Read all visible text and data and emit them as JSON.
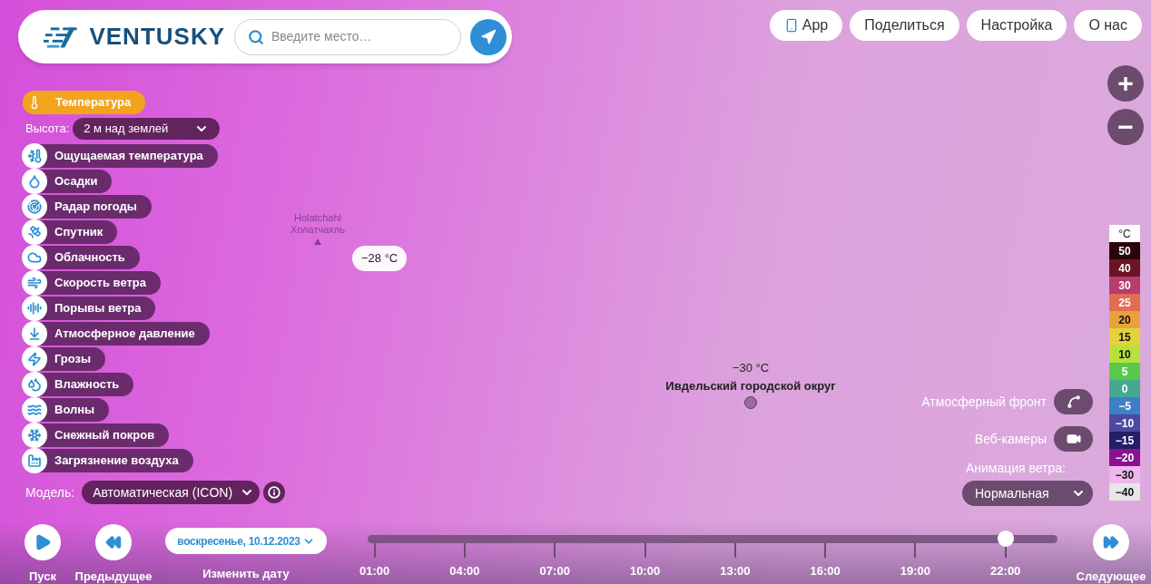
{
  "header": {
    "logo": "VENTUSKY",
    "search": {
      "placeholder": "Введите место…"
    }
  },
  "nav": [
    {
      "label": "App",
      "kind": "app"
    },
    {
      "label": "Поделиться",
      "kind": "plain"
    },
    {
      "label": "Настройка",
      "kind": "plain"
    },
    {
      "label": "О нас",
      "kind": "plain"
    }
  ],
  "zoom": {
    "in": "+",
    "out": "−"
  },
  "layers": {
    "active": {
      "label": "Температура",
      "selected": true
    },
    "height": {
      "label": "Высота:",
      "value": "2 м над землей"
    },
    "items": [
      {
        "label": "Ощущаемая температура",
        "selected": false
      },
      {
        "label": "Осадки",
        "selected": false
      },
      {
        "label": "Радар погоды",
        "selected": false
      },
      {
        "label": "Спутник",
        "selected": false
      },
      {
        "label": "Облачность",
        "selected": false
      },
      {
        "label": "Скорость ветра",
        "selected": false
      },
      {
        "label": "Порывы ветра",
        "selected": false
      },
      {
        "label": "Атмосферное давление",
        "selected": false
      },
      {
        "label": "Грозы",
        "selected": false
      },
      {
        "label": "Влажность",
        "selected": false
      },
      {
        "label": "Волны",
        "selected": false
      },
      {
        "label": "Снежный покров",
        "selected": false
      },
      {
        "label": "Загрязнение воздуха",
        "selected": false
      }
    ],
    "model": {
      "label": "Модель:",
      "value": "Автоматическая (ICON)"
    }
  },
  "map": {
    "places": [
      {
        "name": "Holatchahl",
        "name_local": "Холатчахль"
      }
    ],
    "readings": [
      {
        "value": "−28 °C",
        "kind": "pill"
      },
      {
        "value": "−30 °C",
        "kind": "city",
        "city": "Ивдельский городской округ"
      }
    ]
  },
  "legend": {
    "unit": "°C",
    "items": [
      {
        "label": "50",
        "color": "#2a0508"
      },
      {
        "label": "40",
        "color": "#6a1527"
      },
      {
        "label": "30",
        "color": "#b73d6f"
      },
      {
        "label": "25",
        "color": "#e16d53"
      },
      {
        "label": "20",
        "color": "#e9a23a"
      },
      {
        "label": "15",
        "color": "#e2d23c"
      },
      {
        "label": "10",
        "color": "#b9e03d"
      },
      {
        "label": "5",
        "color": "#5ac84a"
      },
      {
        "label": "0",
        "color": "#45a98f"
      },
      {
        "label": "−5",
        "color": "#3f7fc6"
      },
      {
        "label": "−10",
        "color": "#4b4aa2"
      },
      {
        "label": "−15",
        "color": "#241d68"
      },
      {
        "label": "−20",
        "color": "#8a1191"
      },
      {
        "label": "−30",
        "color": "#f0b6ee"
      },
      {
        "label": "−40",
        "color": "#e6e6e6"
      }
    ]
  },
  "overlays": {
    "front": {
      "label": "Атмосферный фронт",
      "on": false
    },
    "webcams": {
      "label": "Веб-камеры",
      "on": false
    },
    "wind": {
      "label": "Анимация ветра:",
      "value": "Нормальная"
    }
  },
  "timeline": {
    "play": "Пуск",
    "previous": "Предыдущее",
    "date": "воскресенье, 10.12.2023",
    "change_date": "Изменить дату",
    "next": "Следующее",
    "level": 0.925,
    "ticks": [
      "01:00",
      "04:00",
      "07:00",
      "10:00",
      "13:00",
      "16:00",
      "19:00",
      "22:00"
    ]
  }
}
